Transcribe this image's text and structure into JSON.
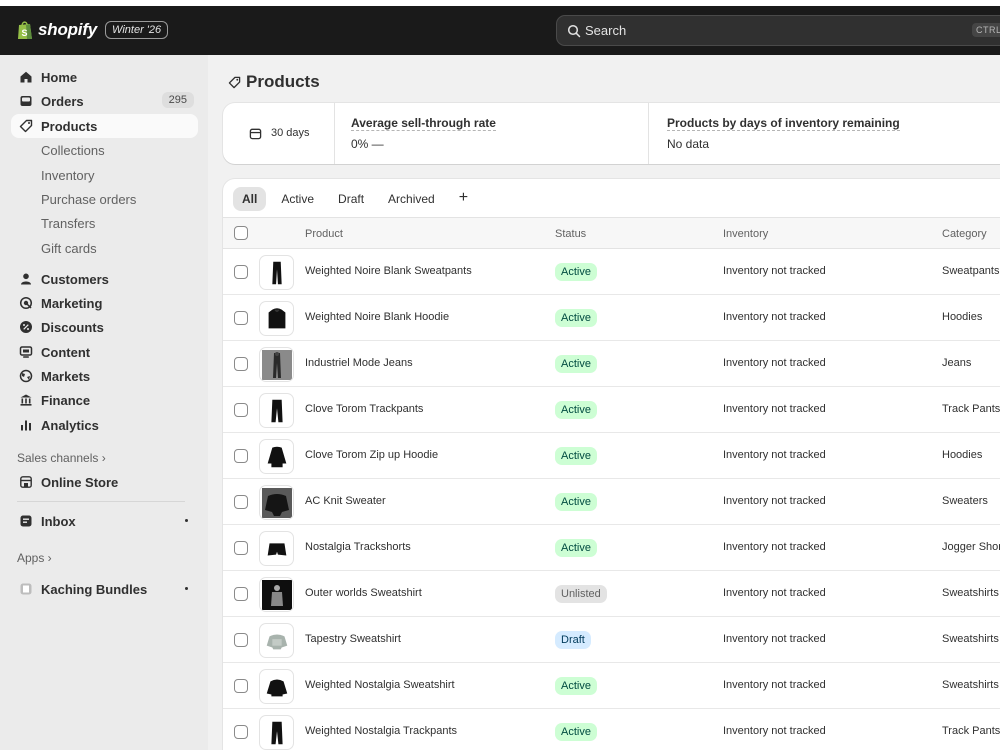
{
  "topbar": {
    "brand": "shopify",
    "badge": "Winter '26",
    "search_placeholder": "Search",
    "search_shortcut": "CTRL"
  },
  "sidebar": {
    "home": "Home",
    "orders": "Orders",
    "orders_count": "295",
    "products": "Products",
    "collections": "Collections",
    "inventory": "Inventory",
    "purchase_orders": "Purchase orders",
    "transfers": "Transfers",
    "gift_cards": "Gift cards",
    "customers": "Customers",
    "marketing": "Marketing",
    "discounts": "Discounts",
    "content": "Content",
    "markets": "Markets",
    "finance": "Finance",
    "analytics": "Analytics",
    "sales_channels": "Sales channels ›",
    "online_store": "Online Store",
    "inbox": "Inbox",
    "apps": "Apps ›",
    "kaching": "Kaching Bundles"
  },
  "page": {
    "title": "Products"
  },
  "metrics": {
    "period": "30 days",
    "sell_through_label": "Average sell-through rate",
    "sell_through_value": "0%  —",
    "days_label": "Products by days of inventory remaining",
    "days_value": "No data"
  },
  "tabs": {
    "all": "All",
    "active": "Active",
    "draft": "Draft",
    "archived": "Archived",
    "add": "+"
  },
  "columns": {
    "product": "Product",
    "status": "Status",
    "inventory": "Inventory",
    "category": "Category"
  },
  "rows": [
    {
      "name": "Weighted Noire Blank Sweatpants",
      "status": "Active",
      "inventory": "Inventory not tracked",
      "category": "Sweatpants"
    },
    {
      "name": "Weighted Noire Blank Hoodie",
      "status": "Active",
      "inventory": "Inventory not tracked",
      "category": "Hoodies"
    },
    {
      "name": "Industriel Mode Jeans",
      "status": "Active",
      "inventory": "Inventory not tracked",
      "category": "Jeans"
    },
    {
      "name": "Clove Torom Trackpants",
      "status": "Active",
      "inventory": "Inventory not tracked",
      "category": "Track Pants"
    },
    {
      "name": "Clove Torom Zip up Hoodie",
      "status": "Active",
      "inventory": "Inventory not tracked",
      "category": "Hoodies"
    },
    {
      "name": "AC Knit Sweater",
      "status": "Active",
      "inventory": "Inventory not tracked",
      "category": "Sweaters"
    },
    {
      "name": "Nostalgia Trackshorts",
      "status": "Active",
      "inventory": "Inventory not tracked",
      "category": "Jogger Shorts"
    },
    {
      "name": "Outer worlds Sweatshirt",
      "status": "Unlisted",
      "inventory": "Inventory not tracked",
      "category": "Sweatshirts"
    },
    {
      "name": "Tapestry Sweatshirt",
      "status": "Draft",
      "inventory": "Inventory not tracked",
      "category": "Sweatshirts"
    },
    {
      "name": "Weighted Nostalgia Sweatshirt",
      "status": "Active",
      "inventory": "Inventory not tracked",
      "category": "Sweatshirts"
    },
    {
      "name": "Weighted Nostalgia Trackpants",
      "status": "Active",
      "inventory": "Inventory not tracked",
      "category": "Track Pants"
    }
  ]
}
